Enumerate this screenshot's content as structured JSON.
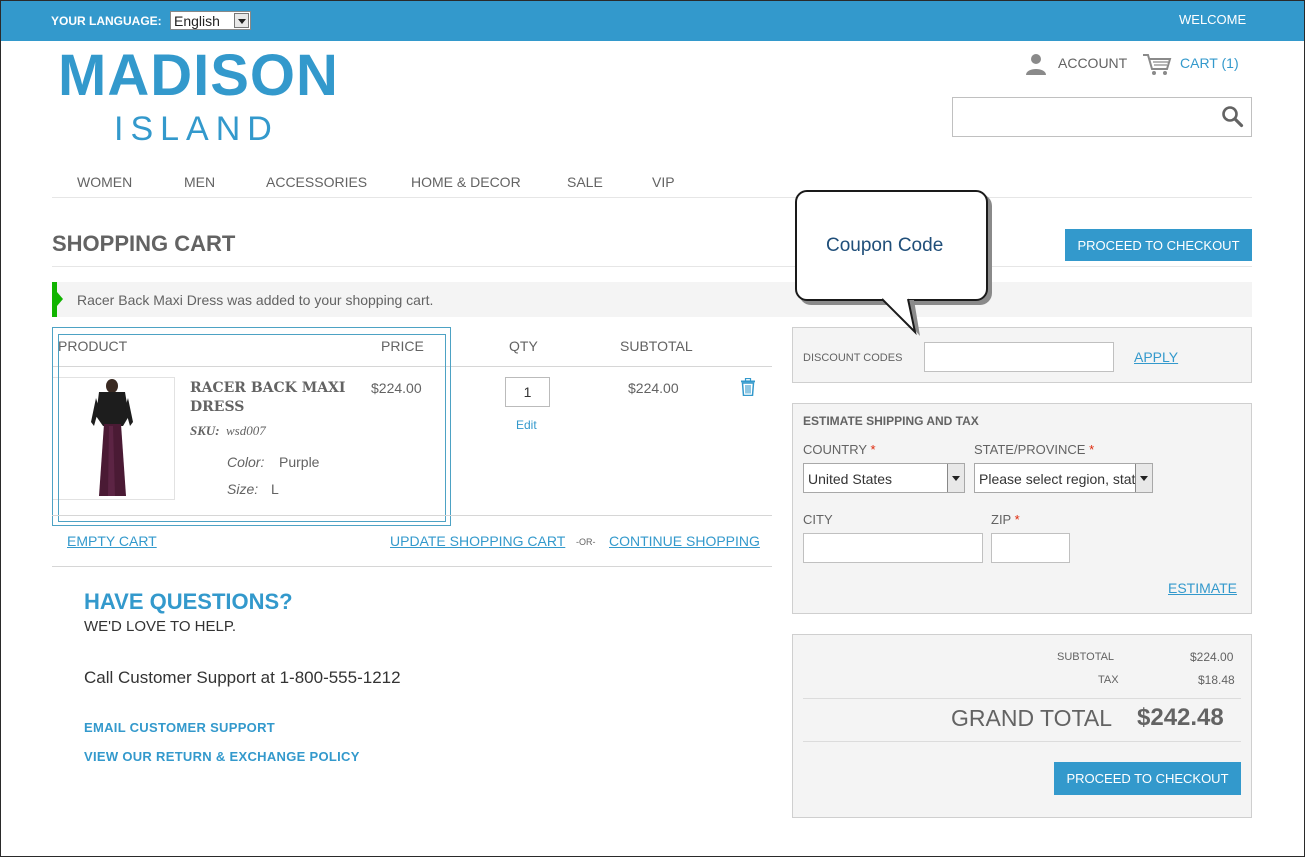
{
  "topbar": {
    "language_label": "YOUR LANGUAGE:",
    "language_value": "English",
    "welcome": "WELCOME"
  },
  "logo": {
    "line1": "MADISON",
    "line2": "ISLAND"
  },
  "header": {
    "account": "ACCOUNT",
    "cart": "CART (1)",
    "search_value": ""
  },
  "nav": {
    "items": [
      "WOMEN",
      "MEN",
      "ACCESSORIES",
      "HOME & DECOR",
      "SALE",
      "VIP"
    ]
  },
  "page": {
    "title": "SHOPPING CART",
    "checkout_label": "PROCEED TO CHECKOUT"
  },
  "message": {
    "text": "Racer Back Maxi Dress was added to your shopping cart."
  },
  "cart": {
    "headers": {
      "product": "PRODUCT",
      "price": "PRICE",
      "qty": "QTY",
      "subtotal": "SUBTOTAL"
    },
    "item": {
      "name": "RACER BACK MAXI DRESS",
      "sku_label": "SKU:",
      "sku": "wsd007",
      "color_label": "Color:",
      "color": "Purple",
      "size_label": "Size:",
      "size": "L",
      "price": "$224.00",
      "qty": "1",
      "edit": "Edit",
      "subtotal": "$224.00"
    },
    "actions": {
      "empty": "EMPTY CART",
      "update": "UPDATE SHOPPING CART",
      "or": "-OR-",
      "continue": "CONTINUE SHOPPING"
    }
  },
  "questions": {
    "title": "HAVE QUESTIONS?",
    "subtitle": "WE'D LOVE TO HELP.",
    "call": "Call Customer Support at 1-800-555-1212",
    "email": "EMAIL CUSTOMER SUPPORT",
    "returns": "VIEW OUR RETURN & EXCHANGE POLICY"
  },
  "callout": {
    "text": "Coupon Code"
  },
  "discount": {
    "label": "DISCOUNT CODES",
    "value": "",
    "apply": "APPLY"
  },
  "estimate": {
    "title": "ESTIMATE SHIPPING AND TAX",
    "country_label": "COUNTRY",
    "country_value": "United States",
    "state_label": "STATE/PROVINCE",
    "state_value": "Please select region, state or province",
    "city_label": "CITY",
    "zip_label": "ZIP",
    "required_mark": "*",
    "button": "ESTIMATE"
  },
  "totals": {
    "subtotal_label": "SUBTOTAL",
    "subtotal": "$224.00",
    "tax_label": "TAX",
    "tax": "$18.48",
    "grand_label": "GRAND TOTAL",
    "grand": "$242.48",
    "checkout_label": "PROCEED TO CHECKOUT"
  },
  "colors": {
    "brand": "#3399cc",
    "success": "#11b400",
    "required": "#df280a"
  },
  "icons": [
    "user-icon",
    "cart-icon",
    "search-icon",
    "trash-icon"
  ]
}
